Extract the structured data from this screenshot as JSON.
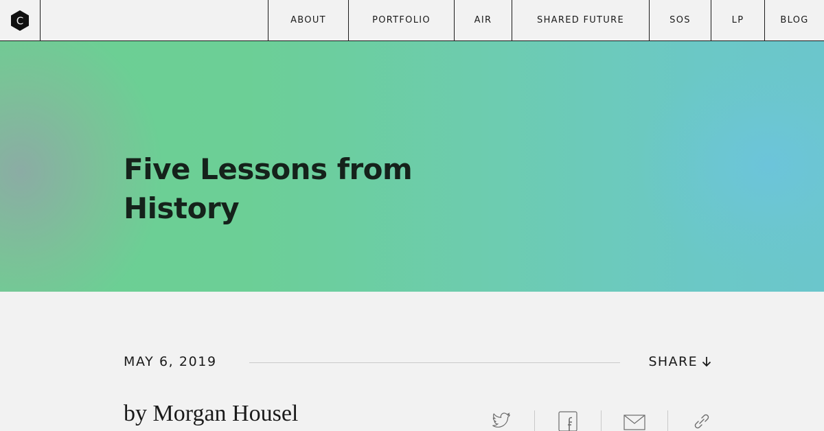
{
  "brand": {
    "logo_letter": "C",
    "logo_icon": "hexagon-logo-icon"
  },
  "nav": {
    "items": [
      {
        "label": "ABOUT"
      },
      {
        "label": "PORTFOLIO"
      },
      {
        "label": "AIR"
      },
      {
        "label": "SHARED FUTURE"
      },
      {
        "label": "SOS"
      },
      {
        "label": "LP"
      },
      {
        "label": "BLOG"
      }
    ]
  },
  "hero": {
    "title": "Five Lessons from History",
    "colors": {
      "green": "#6ccf93",
      "teal": "#6dccb0",
      "blue": "#6bc6cc",
      "grey_tint": "#a0a8a8"
    }
  },
  "article": {
    "date": "MAY 6, 2019",
    "share_label": "SHARE",
    "share_icon": "arrow-down-icon",
    "byline": "by Morgan Housel"
  },
  "social_icons": [
    "twitter-icon",
    "facebook-icon",
    "email-icon",
    "link-icon"
  ],
  "colors": {
    "background": "#f2f2f2",
    "text": "#1a1a1a",
    "divider": "#c9c9c9"
  }
}
